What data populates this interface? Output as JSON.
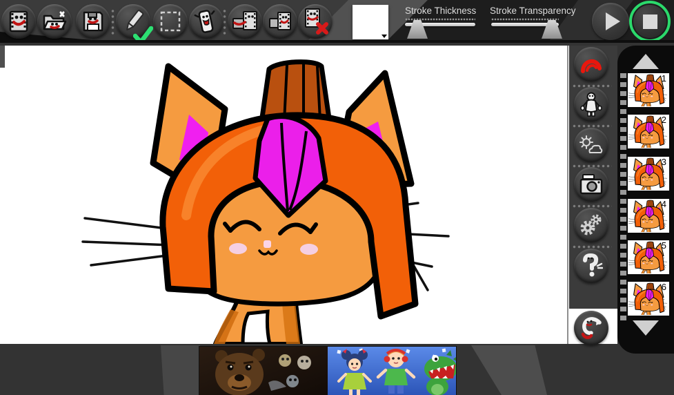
{
  "toolbar": {
    "file_buttons": [
      {
        "name": "movies",
        "icon": "film-reel-face-icon"
      },
      {
        "name": "open",
        "icon": "open-folder-face-icon"
      },
      {
        "name": "save",
        "icon": "floppy-disk-face-icon"
      }
    ],
    "tool_buttons": [
      {
        "name": "pen",
        "icon": "pen-icon",
        "active": true,
        "checkmark_color": "#2ce072"
      },
      {
        "name": "select",
        "icon": "selection-rectangle-icon",
        "active": false
      },
      {
        "name": "eraser",
        "icon": "eraser-face-icon",
        "active": false
      }
    ],
    "frame_buttons": [
      {
        "name": "copy-frame",
        "icon": "film-frames-copy-icon"
      },
      {
        "name": "insert-frame",
        "icon": "film-frames-icon"
      },
      {
        "name": "delete-frame",
        "icon": "film-frame-delete-icon",
        "badge_color": "#d81a1a"
      }
    ],
    "color_swatch": {
      "selected_color": "#000000"
    },
    "sliders": [
      {
        "label": "Stroke Thickness",
        "value_percent": 18
      },
      {
        "label": "Stroke Transparency",
        "value_percent": 90
      }
    ],
    "playback": {
      "play": {
        "icon": "play-icon",
        "active": false
      },
      "stop": {
        "icon": "stop-icon",
        "active": true,
        "ring_color": "#2bd96b"
      }
    }
  },
  "side_tools": [
    {
      "name": "stroke-preview",
      "icon": "red-arc-icon",
      "color": "#e8170d"
    },
    {
      "name": "characters",
      "icon": "person-icon"
    },
    {
      "name": "scenery",
      "icon": "sun-cloud-icon"
    },
    {
      "name": "photo",
      "icon": "camera-icon"
    },
    {
      "name": "settings",
      "icon": "gears-icon"
    },
    {
      "name": "help",
      "icon": "question-mark-icon"
    },
    {
      "name": "undo",
      "icon": "undo-arrow-face-icon"
    }
  ],
  "frames_panel": {
    "scroll_up_icon": "up-arrow-icon",
    "scroll_down_icon": "down-arrow-icon",
    "frames": [
      {
        "number": "1"
      },
      {
        "number": "2"
      },
      {
        "number": "3"
      },
      {
        "number": "4"
      },
      {
        "number": "5"
      },
      {
        "number": "6"
      }
    ]
  },
  "canvas": {
    "drawing": "orange cat character with orange helmet-hair, magenta fringe and magenta inner ears",
    "colors": {
      "body": "#F59B40",
      "helmet": "#F26008",
      "mohawk": "#B9500F",
      "magenta": "#EB1FEA",
      "blush": "#F5CFE2",
      "outline": "#000000"
    }
  },
  "ad_banner": {
    "left": "dark animatronic bear game ad",
    "right": "cartoon kids and green dinosaur game ad"
  }
}
